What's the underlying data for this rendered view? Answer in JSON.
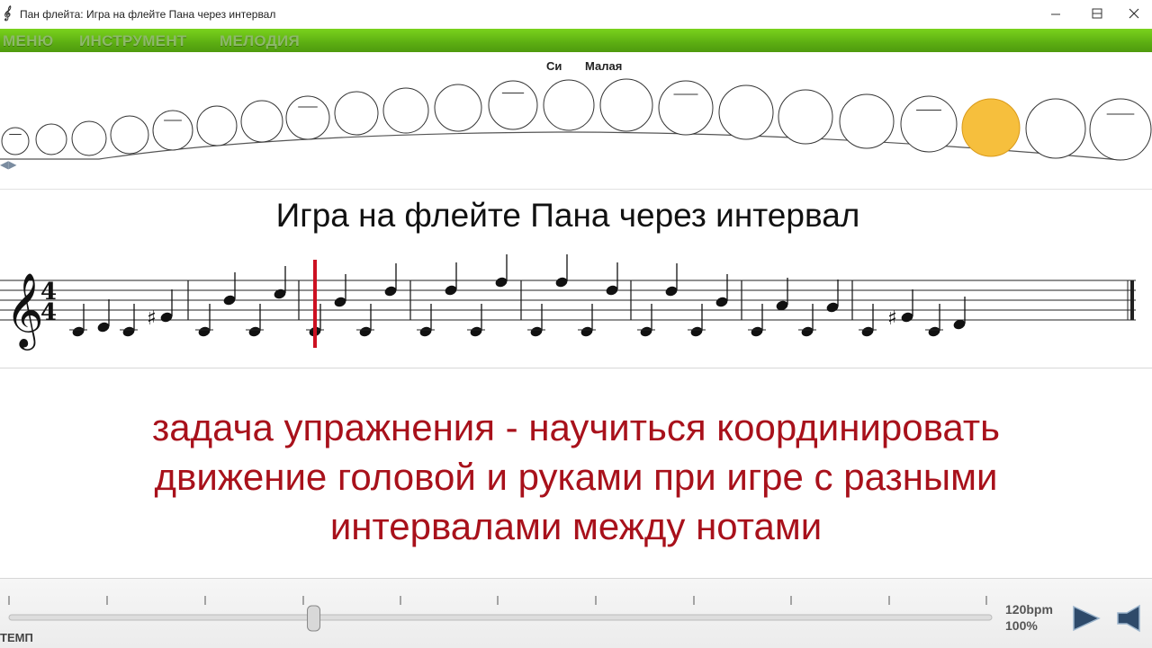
{
  "window": {
    "title": "Пан флейта: Игра на флейте Пана через интервал",
    "icon": "app-logo-icon"
  },
  "menu": {
    "items": [
      "МЕНЮ",
      "ИНСТРУМЕНТ",
      "МЕЛОДИЯ"
    ]
  },
  "flute": {
    "note_name": "Си",
    "octave_name": "Малая",
    "tube_count": 21,
    "active_tube_index": 18,
    "active_color": "#f6bf3d"
  },
  "sheet": {
    "title": "Игра на флейте Пана через интервал",
    "time_signature": {
      "top": "4",
      "bottom": "4"
    },
    "clef": "treble",
    "accent_color": "#cc1122"
  },
  "task": {
    "lines": [
      "задача упражнения - научиться координировать",
      "движение головой и руками при игре с разными",
      "интервалами между нотами"
    ]
  },
  "tempo": {
    "label": "ТЕМП",
    "bpm": "120bpm",
    "percent": "100%",
    "slider_position": 0.31
  },
  "controls": {
    "play_icon": "play-icon",
    "stop_icon": "stop-icon"
  }
}
